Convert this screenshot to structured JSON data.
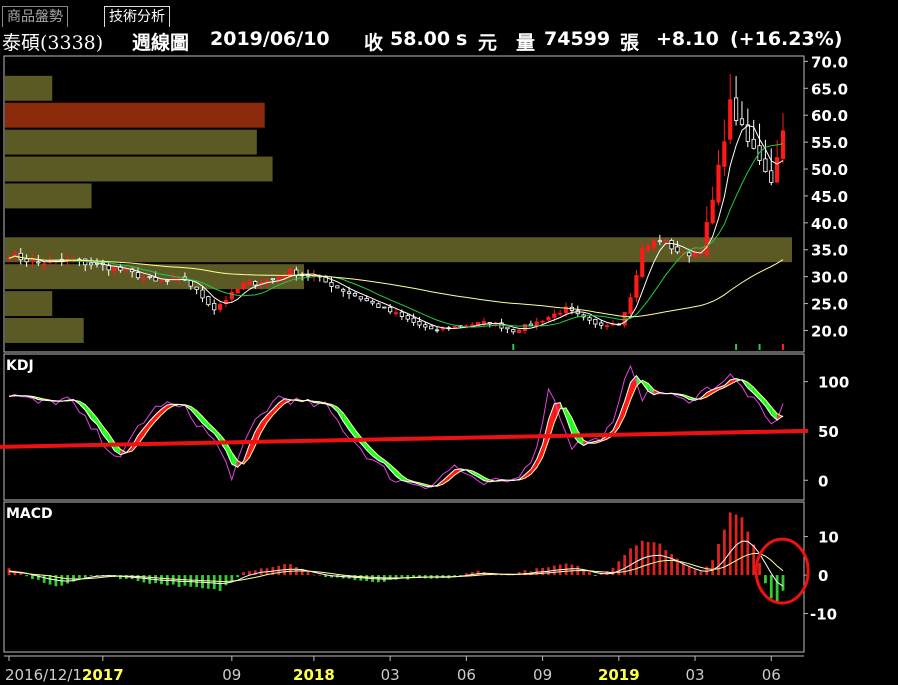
{
  "tabs": [
    {
      "label": "商品盤勢",
      "active": false
    },
    {
      "label": "技術分析",
      "active": true
    }
  ],
  "header": {
    "stock": "泰碩(3338)",
    "period": "週線圖",
    "date": "2019/06/10",
    "close_label": "收",
    "close_value": "58.00",
    "close_flag": "s",
    "currency": "元",
    "volume_label": "量",
    "volume_value": "74599",
    "volume_unit": "張",
    "change": "+8.10",
    "change_pct": "(+16.23%)"
  },
  "colors": {
    "up": "#ff1a1a",
    "down": "#ffffff",
    "ma_short": "#ffffff",
    "ma_mid": "#22cc44",
    "ma_long": "#ffff99",
    "kdj_k": "#ffffff",
    "kdj_d": "#ffff99",
    "kdj_j": "#dd44dd",
    "hist_up": "#dd2222",
    "hist_down": "#33cc33",
    "volume_profile": "#5c5a24",
    "volume_profile_max": "#8a2a0a",
    "reference_line": "#ee1111",
    "highlight_circle": "#ee1111"
  },
  "chart_data": [
    {
      "type": "candlestick",
      "panel": "price",
      "yticks": [
        "70.0",
        "65.0",
        "60.0",
        "55.0",
        "50.0",
        "45.0",
        "40.0",
        "35.0",
        "30.0",
        "25.0",
        "20.0"
      ],
      "ylim": [
        16,
        71
      ],
      "x_axis_labels": [
        {
          "label": "2016/12/12",
          "bold": false
        },
        {
          "label": "2017",
          "bold": true
        },
        {
          "label": "09",
          "bold": false
        },
        {
          "label": "2018",
          "bold": true
        },
        {
          "label": "03",
          "bold": false
        },
        {
          "label": "06",
          "bold": false
        },
        {
          "label": "09",
          "bold": false
        },
        {
          "label": "2019",
          "bold": true
        },
        {
          "label": "03",
          "bold": false
        },
        {
          "label": "06",
          "bold": false
        }
      ],
      "x_axis_label_weeks": [
        0,
        16,
        38,
        52,
        65,
        78,
        91,
        104,
        117,
        130
      ],
      "weeks": 133,
      "close_anchors": [
        [
          0,
          34
        ],
        [
          5,
          32.5
        ],
        [
          10,
          33
        ],
        [
          16,
          32
        ],
        [
          20,
          31
        ],
        [
          25,
          29
        ],
        [
          30,
          29.5
        ],
        [
          35,
          24
        ],
        [
          40,
          28.5
        ],
        [
          45,
          29.5
        ],
        [
          48,
          31
        ],
        [
          52,
          30
        ],
        [
          58,
          27
        ],
        [
          64,
          24
        ],
        [
          68,
          22
        ],
        [
          72,
          20
        ],
        [
          78,
          21
        ],
        [
          82,
          21.5
        ],
        [
          86,
          20
        ],
        [
          90,
          21.5
        ],
        [
          95,
          24
        ],
        [
          100,
          21
        ],
        [
          104,
          21.5
        ],
        [
          106,
          26
        ],
        [
          108,
          35
        ],
        [
          111,
          37
        ],
        [
          115,
          34
        ],
        [
          118,
          35
        ],
        [
          120,
          44
        ],
        [
          123,
          62
        ],
        [
          126,
          55
        ],
        [
          128,
          52
        ],
        [
          130,
          48
        ],
        [
          131,
          52
        ],
        [
          132,
          58
        ]
      ],
      "volume_profile": [
        {
          "price": 65,
          "rel": 0.06
        },
        {
          "price": 60,
          "rel": 0.33
        },
        {
          "price": 55,
          "rel": 0.32
        },
        {
          "price": 50,
          "rel": 0.34
        },
        {
          "price": 45,
          "rel": 0.11
        },
        {
          "price": 35,
          "rel": 1.0
        },
        {
          "price": 30,
          "rel": 0.38
        },
        {
          "price": 25,
          "rel": 0.06
        },
        {
          "price": 20,
          "rel": 0.1
        }
      ],
      "volume_profile_max_price": 60,
      "series": [
        {
          "name": "",
          "role": "ma_short"
        },
        {
          "name": "",
          "role": "ma_mid"
        },
        {
          "name": "",
          "role": "ma_long"
        }
      ]
    },
    {
      "type": "line",
      "panel": "kdj",
      "title": "KDJ",
      "yticks": [
        "100",
        "50",
        "0"
      ],
      "ylim": [
        -20,
        128
      ],
      "reference_level": 48,
      "j_anchors": [
        [
          0,
          88
        ],
        [
          5,
          78
        ],
        [
          10,
          82
        ],
        [
          16,
          40
        ],
        [
          19,
          20
        ],
        [
          22,
          55
        ],
        [
          26,
          78
        ],
        [
          30,
          72
        ],
        [
          35,
          40
        ],
        [
          38,
          5
        ],
        [
          42,
          60
        ],
        [
          46,
          85
        ],
        [
          50,
          78
        ],
        [
          54,
          75
        ],
        [
          58,
          45
        ],
        [
          62,
          20
        ],
        [
          66,
          0
        ],
        [
          72,
          -5
        ],
        [
          76,
          15
        ],
        [
          80,
          -5
        ],
        [
          86,
          0
        ],
        [
          90,
          30
        ],
        [
          92,
          95
        ],
        [
          96,
          35
        ],
        [
          100,
          40
        ],
        [
          103,
          55
        ],
        [
          106,
          120
        ],
        [
          108,
          85
        ],
        [
          111,
          90
        ],
        [
          115,
          80
        ],
        [
          119,
          92
        ],
        [
          123,
          105
        ],
        [
          126,
          88
        ],
        [
          128,
          72
        ],
        [
          130,
          55
        ],
        [
          132,
          74
        ]
      ]
    },
    {
      "type": "bar",
      "panel": "macd",
      "title": "MACD",
      "yticks": [
        "10",
        "0",
        "-10"
      ],
      "ylim": [
        -20,
        19
      ],
      "hist_anchors": [
        [
          0,
          2
        ],
        [
          4,
          -1
        ],
        [
          8,
          -3
        ],
        [
          12,
          -1
        ],
        [
          16,
          0
        ],
        [
          20,
          -1
        ],
        [
          24,
          -2
        ],
        [
          30,
          -3
        ],
        [
          36,
          -4
        ],
        [
          40,
          1
        ],
        [
          44,
          2
        ],
        [
          48,
          3
        ],
        [
          52,
          0
        ],
        [
          58,
          -1
        ],
        [
          62,
          -2
        ],
        [
          68,
          -1
        ],
        [
          74,
          -1
        ],
        [
          80,
          1
        ],
        [
          84,
          0
        ],
        [
          88,
          1
        ],
        [
          92,
          2
        ],
        [
          96,
          3
        ],
        [
          100,
          0
        ],
        [
          103,
          2
        ],
        [
          106,
          7
        ],
        [
          108,
          9
        ],
        [
          111,
          8
        ],
        [
          115,
          3
        ],
        [
          118,
          1
        ],
        [
          120,
          4
        ],
        [
          123,
          16
        ],
        [
          125,
          15
        ],
        [
          127,
          8
        ],
        [
          129,
          -2
        ],
        [
          130,
          -6
        ],
        [
          131,
          -7
        ],
        [
          132,
          -4
        ]
      ]
    }
  ]
}
